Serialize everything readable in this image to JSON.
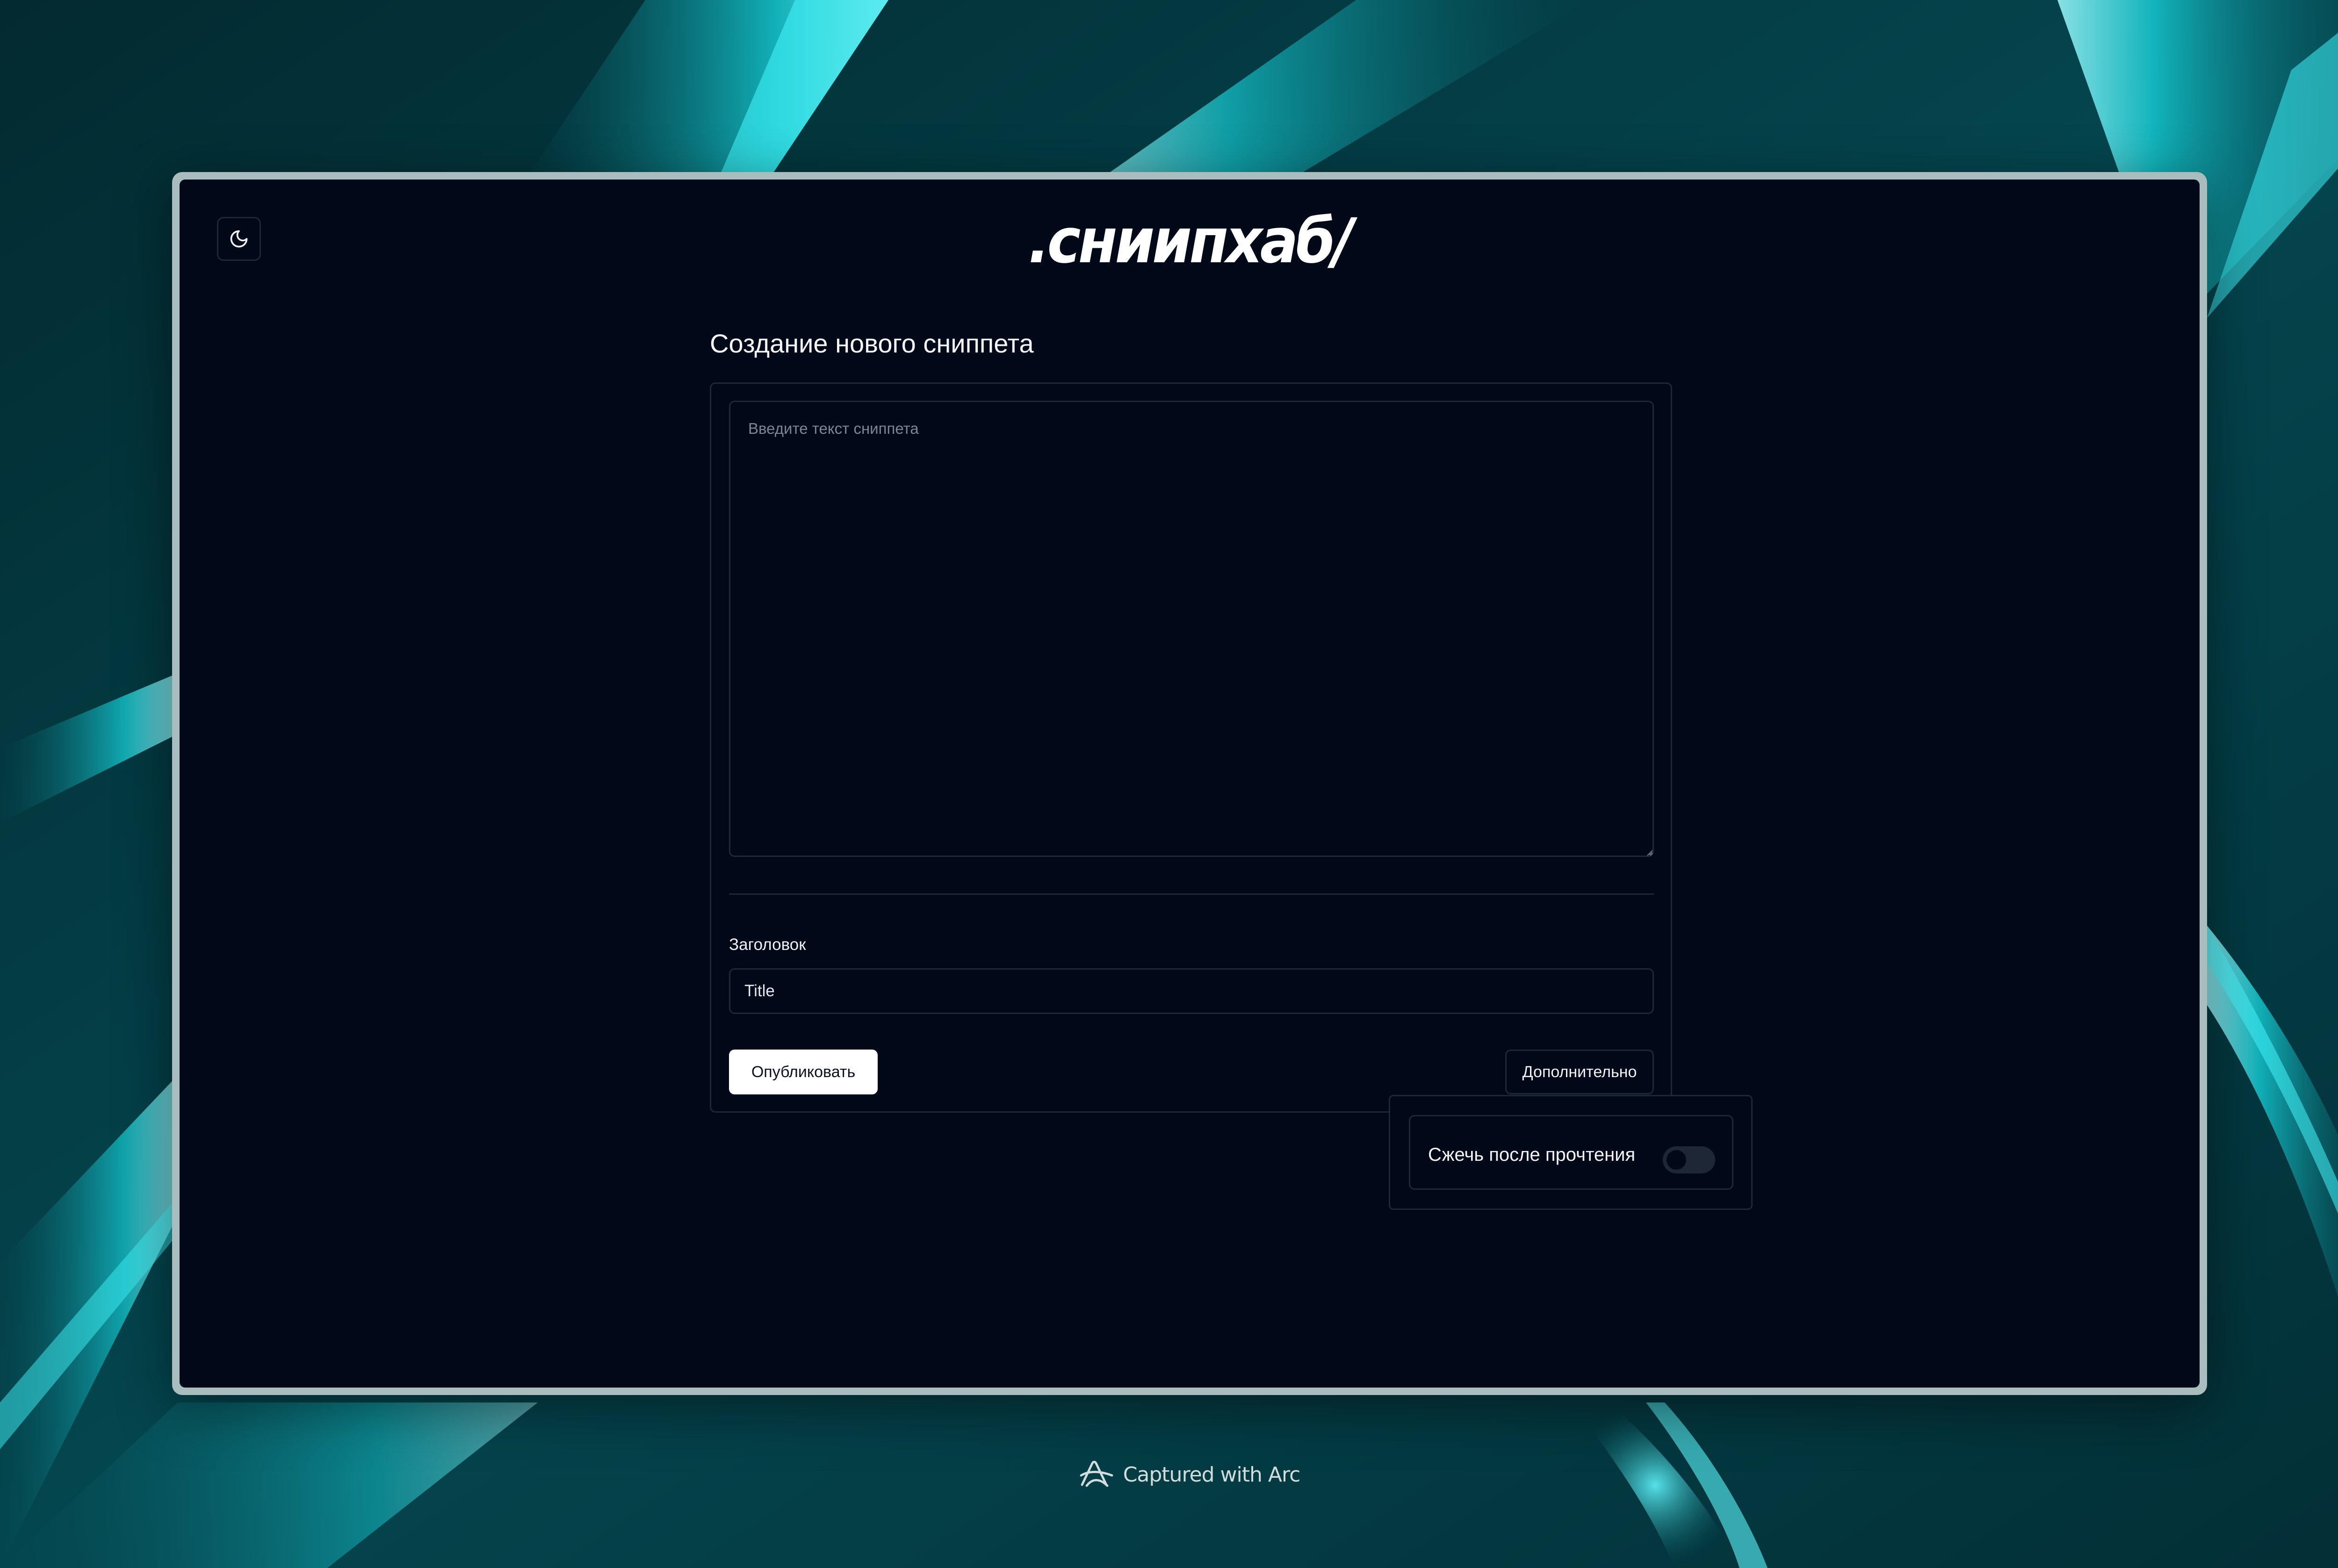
{
  "app": {
    "logo": ".сниипхаб/"
  },
  "header": {
    "theme_toggle_icon": "moon-icon"
  },
  "main": {
    "heading": "Создание нового сниппета",
    "snippet": {
      "placeholder": "Введите текст сниппета",
      "value": ""
    },
    "title_field": {
      "label": "Заголовок",
      "placeholder": "Title",
      "value": ""
    },
    "publish_label": "Опубликовать",
    "more_label": "Дополнительно"
  },
  "advanced_popover": {
    "burn_after_reading_label": "Сжечь после прочтения",
    "burn_after_reading_enabled": false
  },
  "footer": {
    "text": "Captured with Arc",
    "icon": "arc-logo-icon"
  },
  "colors": {
    "page_background": "#010817",
    "border": "#1e2736",
    "accent_cyan": "#19e3ea",
    "wallpaper_dark": "#03343b"
  }
}
